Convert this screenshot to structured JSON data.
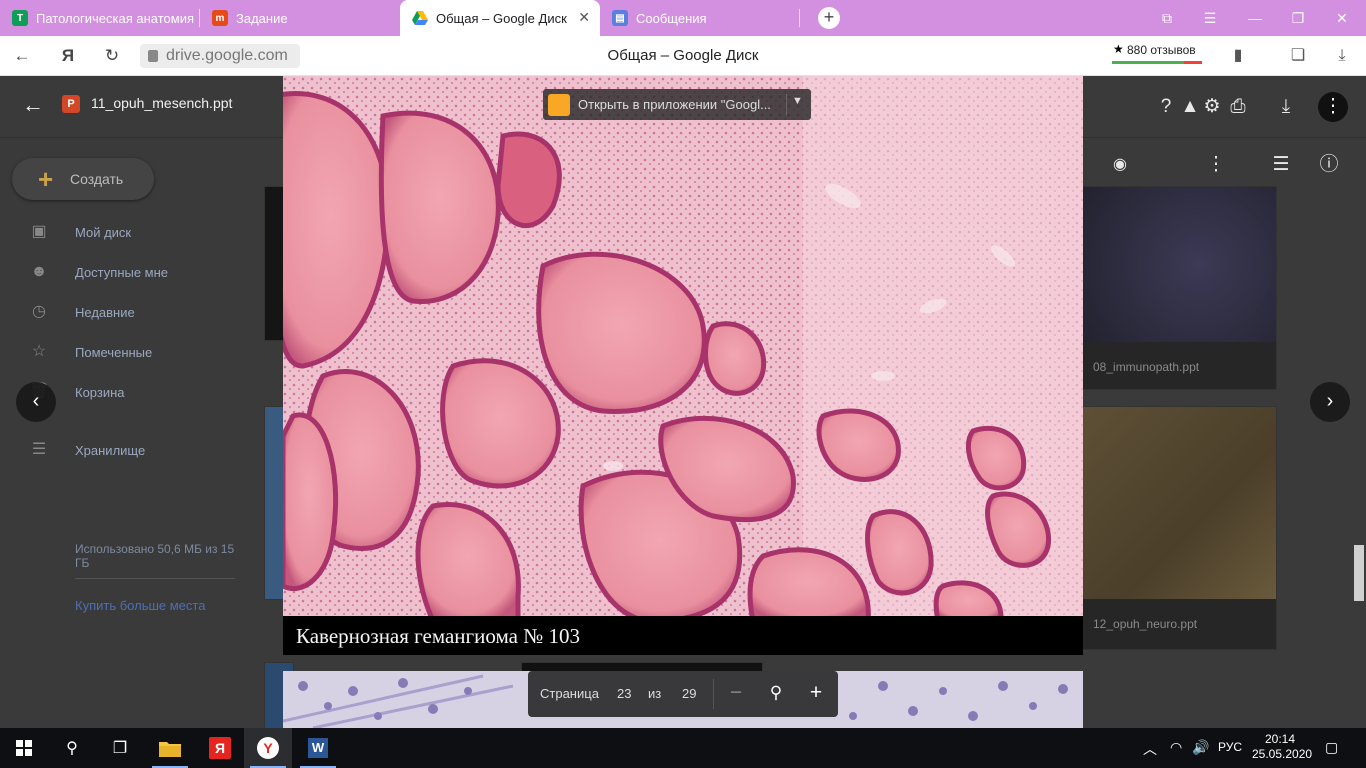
{
  "browser": {
    "tabs": [
      {
        "title": "Патологическая анатомия",
        "favicon": "T",
        "favicon_color": "#0f9d58",
        "active": false
      },
      {
        "title": "Задание",
        "favicon": "m",
        "favicon_color": "#e64a19",
        "active": false
      },
      {
        "title": "Общая – Google Диск",
        "favicon": "drive",
        "favicon_color": "#fbbc04",
        "active": true
      },
      {
        "title": "Сообщения",
        "favicon": "msg",
        "favicon_color": "#5b7fdd",
        "active": false
      }
    ],
    "new_tab_label": "+",
    "url": "drive.google.com",
    "page_title": "Общая – Google Диск",
    "reviews": "880 отзывов"
  },
  "drive": {
    "back_icon": "arrow-left-icon",
    "file_badge": "P",
    "file_name": "11_opuh_mesench.ppt",
    "create_label": "Создать",
    "sidebar": [
      {
        "label": "Мой диск",
        "icon": "drive-icon"
      },
      {
        "label": "Доступные мне",
        "icon": "people-icon"
      },
      {
        "label": "Недавние",
        "icon": "clock-icon"
      },
      {
        "label": "Помеченные",
        "icon": "star-icon"
      },
      {
        "label": "Корзина",
        "icon": "trash-icon"
      },
      {
        "label": "Хранилище",
        "icon": "storage-icon"
      }
    ],
    "storage_used": "Использовано 50,6 МБ из 15 ГБ",
    "buy_storage": "Купить больше места",
    "files": [
      "08_immunopath.ppt",
      "12_opuh_neuro.ppt"
    ]
  },
  "viewer": {
    "open_with": "Открыть в приложении \"Googl...",
    "slide_caption": "Кавернозная гемангиома № 103",
    "page_label": "Страница",
    "current_page": "23",
    "of_label": "из",
    "total_pages": "29",
    "zoom_out": "−",
    "zoom_in": "+"
  },
  "taskbar": {
    "language": "РУС",
    "time": "20:14",
    "date": "25.05.2020"
  },
  "colors": {
    "tab_strip": "#d38fe0",
    "tissue_base": "#e98fa8",
    "tissue_stroma": "#b03a6a"
  }
}
